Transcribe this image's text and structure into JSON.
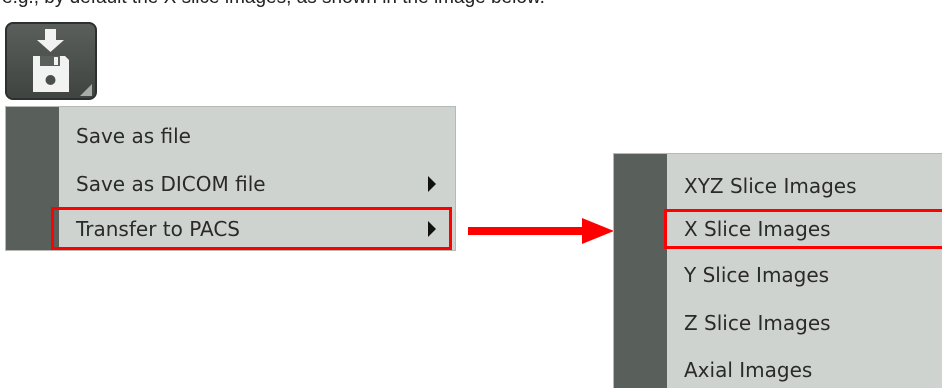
{
  "caption": {
    "text": "e.g., by default the X slice images, as shown in the image below."
  },
  "toolbar": {
    "save_icon": "save-to-disk-icon"
  },
  "save_menu": {
    "items": [
      {
        "label": "Save as file",
        "has_submenu": false,
        "highlighted": false
      },
      {
        "label": "Save as DICOM file",
        "has_submenu": true,
        "highlighted": false
      },
      {
        "label": "Transfer to PACS",
        "has_submenu": true,
        "highlighted": true
      }
    ]
  },
  "pacs_submenu": {
    "items": [
      {
        "label": "XYZ Slice Images",
        "highlighted": false
      },
      {
        "label": "X Slice Images",
        "highlighted": true
      },
      {
        "label": "Y Slice Images",
        "highlighted": false
      },
      {
        "label": "Z Slice Images",
        "highlighted": false
      },
      {
        "label": "Axial Images",
        "highlighted": false
      }
    ]
  },
  "colors": {
    "highlight": "#ff0000",
    "menu_background": "#cfd3cf",
    "menu_gutter": "#59605b",
    "button_background": "#4a4f4c"
  }
}
